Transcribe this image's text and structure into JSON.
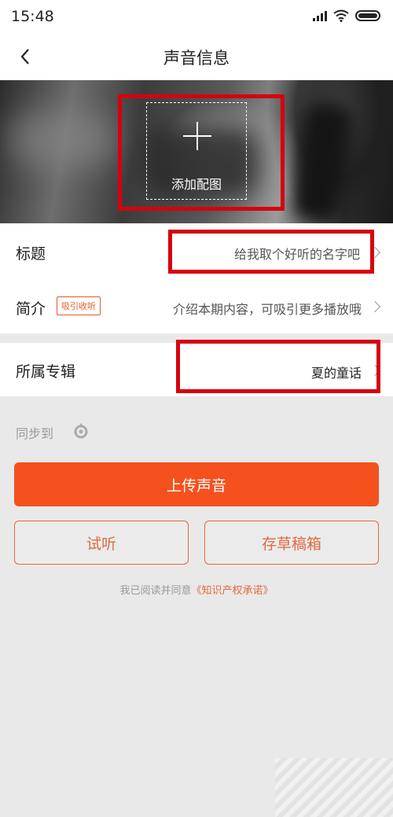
{
  "status_bar": {
    "time": "15:48"
  },
  "nav": {
    "title": "声音信息"
  },
  "cover": {
    "add_label": "添加配图"
  },
  "form": {
    "title_label": "标题",
    "title_placeholder": "给我取个好听的名字吧",
    "intro_label": "简介",
    "intro_tag": "吸引收听",
    "intro_placeholder": "介绍本期内容，可吸引更多播放哦",
    "album_label": "所属专辑",
    "album_value": "夏的童话"
  },
  "sync": {
    "label": "同步到"
  },
  "actions": {
    "upload_label": "上传声音",
    "preview_label": "试听",
    "draft_label": "存草稿箱"
  },
  "agreement": {
    "prefix": "我已阅读并同意",
    "link": "《知识产权承诺》"
  },
  "colors": {
    "accent": "#f4511e",
    "highlight": "#d6000e"
  }
}
